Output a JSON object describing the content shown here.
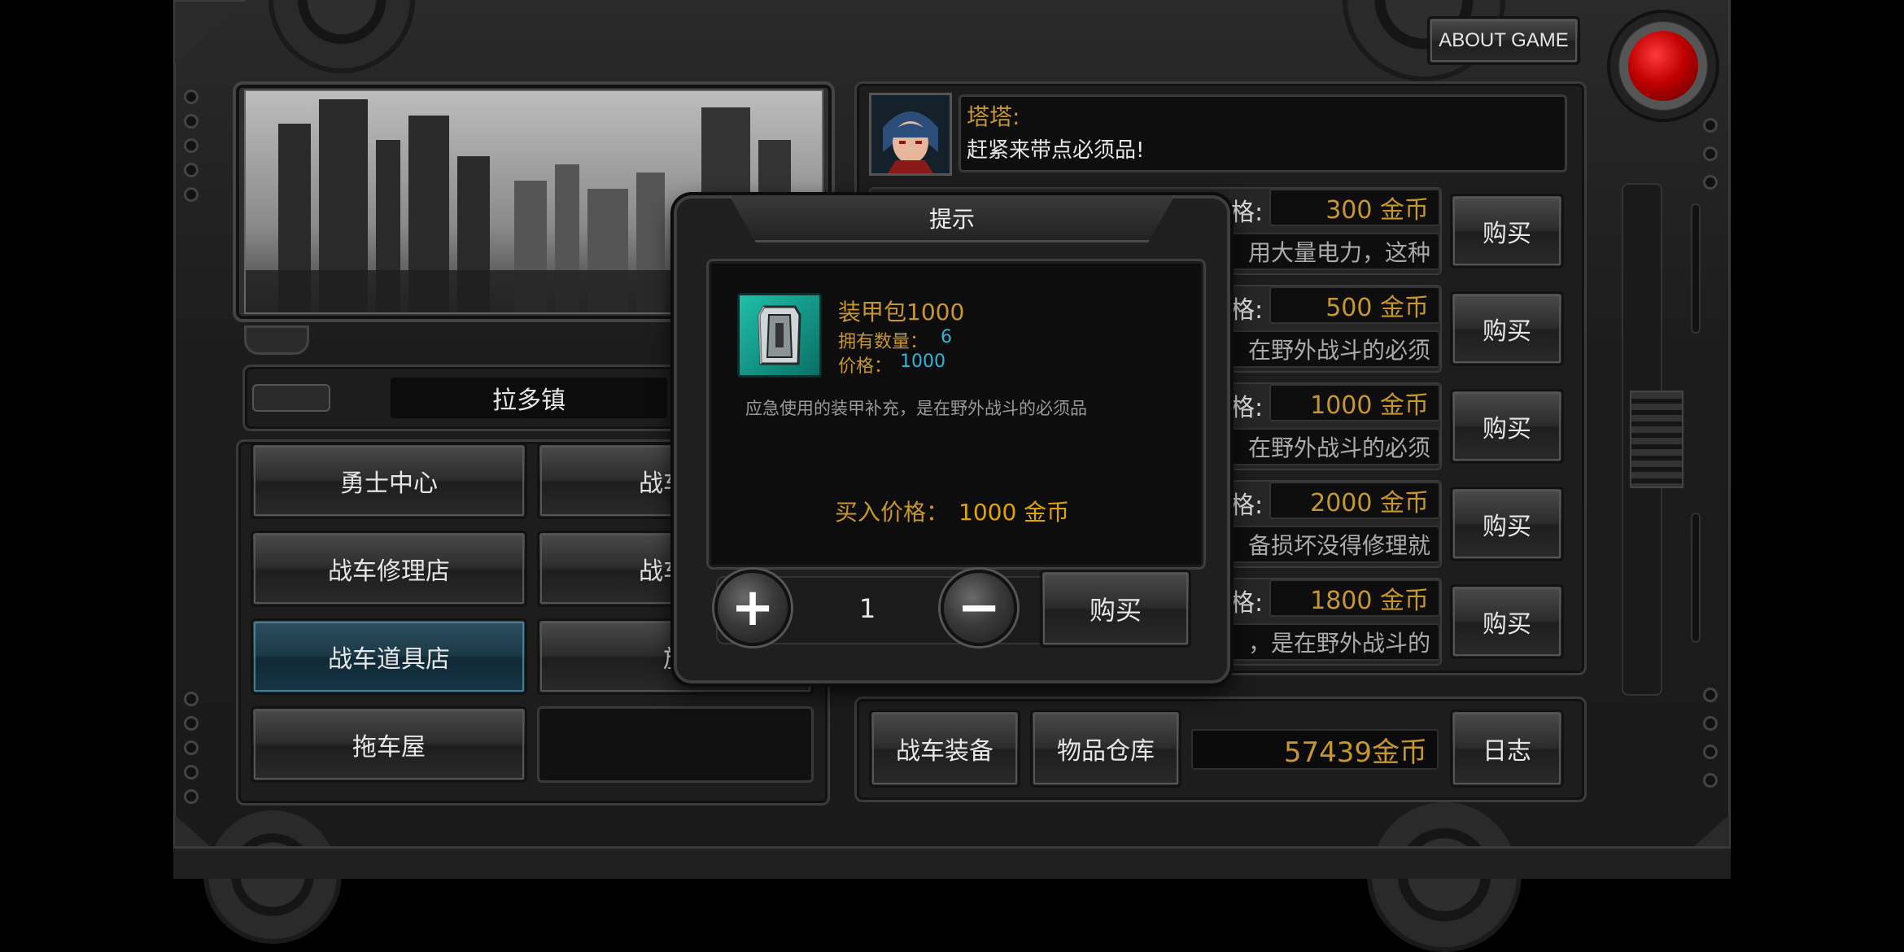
{
  "about_button": "ABOUT GAME",
  "town": {
    "name": "拉多镇"
  },
  "menu": [
    {
      "label": "勇士中心"
    },
    {
      "label": "战车在"
    },
    {
      "label": "战车修理店"
    },
    {
      "label": "战车可"
    },
    {
      "label": "战车道具店"
    },
    {
      "label": "旅"
    },
    {
      "label": "拖车屋"
    },
    {
      "label": ""
    }
  ],
  "npc": {
    "name": "塔塔:",
    "line": "赶紧来带点必须品!"
  },
  "shop_rows": [
    {
      "label": "格:",
      "price": "300 金币",
      "desc": "用大量电力，这种",
      "buy": "购买"
    },
    {
      "label": "格:",
      "price": "500 金币",
      "desc": "在野外战斗的必须",
      "buy": "购买"
    },
    {
      "label": "格:",
      "price": "1000 金币",
      "desc": "在野外战斗的必须",
      "buy": "购买"
    },
    {
      "label": "格:",
      "price": "2000 金币",
      "desc": "备损坏没得修理就",
      "buy": "购买"
    },
    {
      "label": "格:",
      "price": "1800 金币",
      "desc": "，是在野外战斗的",
      "buy": "购买"
    }
  ],
  "bottom_bar": {
    "equip": "战车装备",
    "warehouse": "物品仓库",
    "gold": "57439金币",
    "log": "日志"
  },
  "dialog": {
    "title": "提示",
    "item_name": "装甲包1000",
    "owned_label": "拥有数量：",
    "owned_value": "6",
    "price_label": "价格：",
    "price_value": "1000",
    "description": "应急使用的装甲补充，是在野外战斗的必须品",
    "buy_price_label": "买入价格：",
    "buy_price_value": "1000 金币",
    "quantity": "1",
    "plus": "+",
    "minus": "−",
    "buy": "购买"
  },
  "colors": {
    "gold_text": "#c8962e",
    "cyan_value": "#2fb6d8",
    "selected_tab": "#1b3a48",
    "red_button": "#b00000"
  }
}
